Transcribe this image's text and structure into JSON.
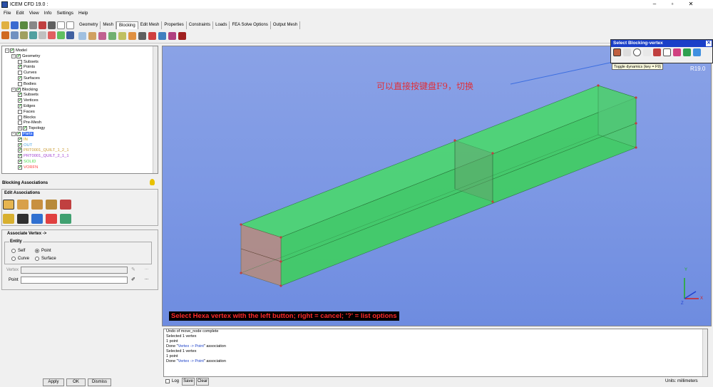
{
  "window": {
    "title": "ICEM CFD 19.0 :",
    "controls": [
      "–",
      "▫",
      "✕"
    ]
  },
  "menu": [
    "File",
    "Edit",
    "View",
    "Info",
    "Settings",
    "Help"
  ],
  "tabs": [
    "Geometry",
    "Mesh",
    "Blocking",
    "Edit Mesh",
    "Properties",
    "Constraints",
    "Loads",
    "FEA Solve Options",
    "Output Mesh"
  ],
  "active_tab": "Blocking",
  "tree": [
    {
      "label": "Model",
      "level": 0,
      "checked": true,
      "expander": "−"
    },
    {
      "label": "Geometry",
      "level": 1,
      "checked": true,
      "expander": "−"
    },
    {
      "label": "Subsets",
      "level": 2,
      "checked": false
    },
    {
      "label": "Points",
      "level": 2,
      "checked": true
    },
    {
      "label": "Curves",
      "level": 2,
      "checked": false
    },
    {
      "label": "Surfaces",
      "level": 2,
      "checked": true
    },
    {
      "label": "Bodies",
      "level": 2,
      "checked": false
    },
    {
      "label": "Blocking",
      "level": 1,
      "checked": true,
      "expander": "−"
    },
    {
      "label": "Subsets",
      "level": 2,
      "checked": true
    },
    {
      "label": "Vertices",
      "level": 2,
      "checked": true
    },
    {
      "label": "Edges",
      "level": 2,
      "checked": true
    },
    {
      "label": "Faces",
      "level": 2,
      "checked": false
    },
    {
      "label": "Blocks",
      "level": 2,
      "checked": false
    },
    {
      "label": "Pre-Mesh",
      "level": 2,
      "checked": false
    },
    {
      "label": "Topology",
      "level": 2,
      "checked": true,
      "expander": "+"
    },
    {
      "label": "Parts",
      "level": 1,
      "checked": true,
      "expander": "−",
      "highlight": true
    },
    {
      "label": "IN",
      "level": 2,
      "checked": true,
      "color": "#d9a400"
    },
    {
      "label": "OUT",
      "level": 2,
      "checked": true,
      "color": "#4aa6e6"
    },
    {
      "label": "PRT0001_QUILT_1_2_1",
      "level": 2,
      "checked": true,
      "color": "#c99a30"
    },
    {
      "label": "PRT0001_QUILT_2_1_1",
      "level": 2,
      "checked": true,
      "color": "#a040d0"
    },
    {
      "label": "SOLID",
      "level": 2,
      "checked": true,
      "color": "#4ad94a"
    },
    {
      "label": "VORFN",
      "level": 2,
      "checked": true,
      "color": "#ff4040"
    }
  ],
  "assoc": {
    "title": "Blocking Associations",
    "edit_label": "Edit Associations",
    "associate_label": "Associate Vertex ->",
    "entity_label": "Entity",
    "opt_self": "Self",
    "opt_point": "Point",
    "opt_curve": "Curve",
    "opt_surface": "Surface",
    "vertex_label": "Vertex",
    "point_label": "Point",
    "apply": "Apply",
    "ok": "OK",
    "dismiss": "Dismiss"
  },
  "viewport": {
    "annotation": "可以直接按键盘F9，切换",
    "version": "R19.0",
    "status": "Select Hexa vertex with the left button; right = cancel; '?' = list options"
  },
  "select_panel": {
    "title": "Select Blocking-vertex",
    "tooltip": "Toggle dynamics (key = F9)"
  },
  "messages": [
    {
      "text": "Undo of move_node complete"
    },
    {
      "text": "Selected 1 vertex"
    },
    {
      "text": "1 point"
    },
    {
      "pre": "Done \"",
      "hl": "Vertex -> Point",
      "post": "\" association"
    },
    {
      "text": "Selected 1 vertex"
    },
    {
      "text": "1 point"
    },
    {
      "pre": "Done \"",
      "hl": "Vertex -> Point",
      "post": "\" association"
    }
  ],
  "bottom": {
    "log": "Log",
    "save": "Save",
    "clear": "Clear",
    "units": "Units: millimeters"
  },
  "colors": {
    "accent": "#1a3fc8",
    "viewport_bg": "#7d98e4",
    "box_fill": "#45e06a",
    "status_red": "#ff2a2a"
  }
}
